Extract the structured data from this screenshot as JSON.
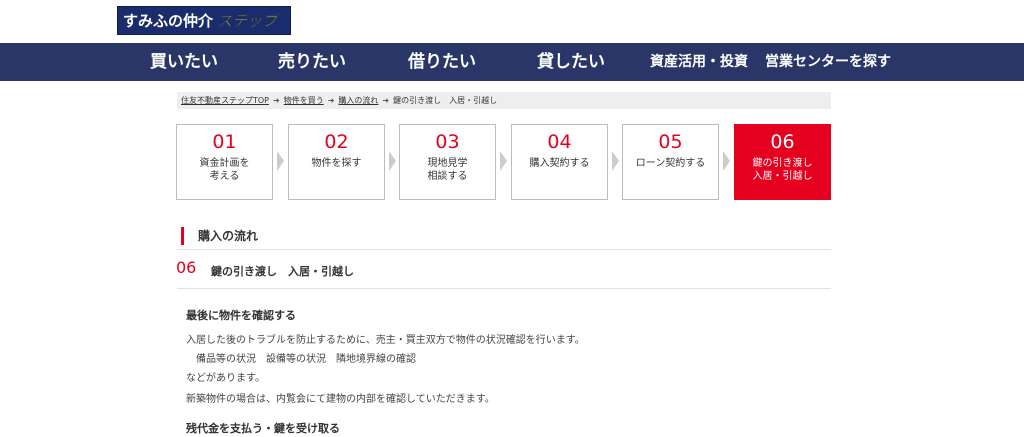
{
  "header": {
    "logo_text": "すみふの仲介",
    "logo_accent": "ステップ"
  },
  "nav": {
    "items": [
      "買いたい",
      "売りたい",
      "借りたい",
      "貸したい",
      "資産活用・投資",
      "営業センターを探す"
    ]
  },
  "breadcrumb": {
    "items": [
      "住友不動産ステップTOP",
      "物件を買う",
      "購入の流れ",
      "鍵の引き渡し　入居・引越し"
    ]
  },
  "steps": [
    {
      "num": "01",
      "label": "資金計画を\n考える"
    },
    {
      "num": "02",
      "label": "物件を探す"
    },
    {
      "num": "03",
      "label": "現地見学\n相談する"
    },
    {
      "num": "04",
      "label": "購入契約する"
    },
    {
      "num": "05",
      "label": "ローン契約する"
    },
    {
      "num": "06",
      "label": "鍵の引き渡し\n入居・引越し"
    }
  ],
  "section": {
    "title": "購入の流れ",
    "sub_num": "06",
    "sub_title": "鍵の引き渡し　入居・引越し"
  },
  "content": {
    "h1": "最後に物件を確認する",
    "p1": "入居した後のトラブルを防止するために、売主・買主双方で物件の状況確認を行います。",
    "p2": "　備品等の状況　設備等の状況　隣地境界線の確認",
    "p3": "などがあります。",
    "p4": "新築物件の場合は、内覧会にて建物の内部を確認していただきます。",
    "h2": "残代金を支払う・鍵を受け取る"
  },
  "colors": {
    "nav_bg": "#2b3668",
    "accent_red": "#e6001f",
    "logo_bg": "#1a2c6b",
    "logo_yellow": "#ffe100"
  }
}
